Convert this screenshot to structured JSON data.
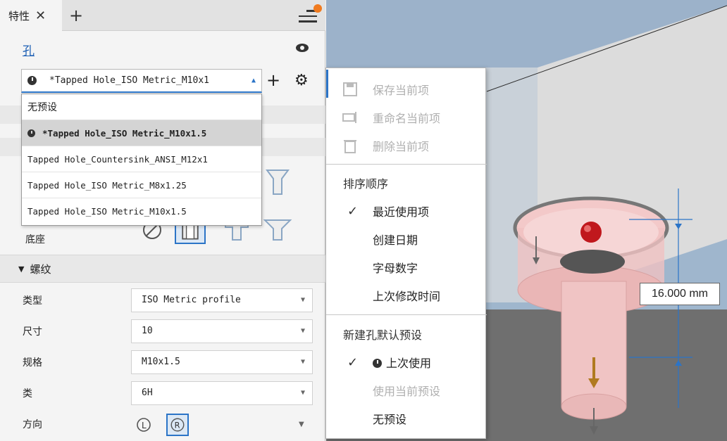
{
  "tab": {
    "label": "特性"
  },
  "hole": {
    "title": "孔"
  },
  "preset": {
    "current": "*Tapped Hole_ISO Metric_M10x1",
    "options": [
      "无预设",
      "*Tapped Hole_ISO Metric_M10x1.5",
      "Tapped Hole_Countersink_ANSI_M12x1",
      "Tapped Hole_ISO Metric_M8x1.25",
      "Tapped Hole_ISO Metric_M10x1.5"
    ]
  },
  "seat": {
    "label": "底座"
  },
  "thread": {
    "header": "螺纹",
    "rows": [
      {
        "label": "类型",
        "value": "ISO Metric profile"
      },
      {
        "label": "尺寸",
        "value": "10"
      },
      {
        "label": "规格",
        "value": "M10x1.5"
      },
      {
        "label": "类",
        "value": "6H"
      },
      {
        "label": "方向",
        "value": ""
      }
    ]
  },
  "context_menu": {
    "save": "保存当前项",
    "rename": "重命名当前项",
    "delete": "删除当前项",
    "sort_header": "排序顺序",
    "sort_recent": "最近使用项",
    "sort_date": "创建日期",
    "sort_alpha": "字母数字",
    "sort_modified": "上次修改时间",
    "default_header": "新建孔默认预设",
    "default_last": "上次使用",
    "default_current": "使用当前预设",
    "default_none": "无预设"
  },
  "viewport": {
    "dimension": "16.000 mm"
  },
  "colors": {
    "accent": "#2b74c7",
    "notification": "#f07a1e",
    "hole_fill": "#f2c7c7"
  }
}
